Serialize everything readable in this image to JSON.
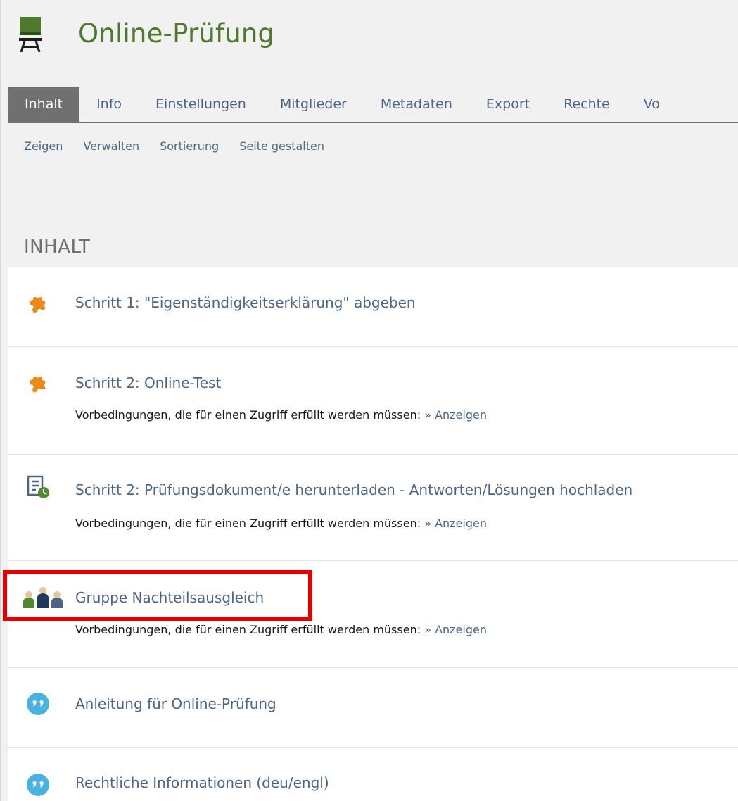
{
  "header": {
    "title": "Online-Prüfung",
    "icon": "classroom-desk-icon"
  },
  "tabs": [
    {
      "label": "Inhalt",
      "active": true
    },
    {
      "label": "Info"
    },
    {
      "label": "Einstellungen"
    },
    {
      "label": "Mitglieder"
    },
    {
      "label": "Metadaten"
    },
    {
      "label": "Export"
    },
    {
      "label": "Rechte"
    },
    {
      "label": "Vo"
    }
  ],
  "subtabs": [
    {
      "label": "Zeigen",
      "active": true
    },
    {
      "label": "Verwalten"
    },
    {
      "label": "Sortierung"
    },
    {
      "label": "Seite gestalten"
    }
  ],
  "section_title": "INHALT",
  "items": [
    {
      "title": "Schritt 1: \"Eigenständigkeitserklärung\" abgeben",
      "icon": "puzzle-icon"
    },
    {
      "title": "Schritt 2: Online-Test",
      "icon": "puzzle-icon",
      "meta_prefix": "Vorbedingungen, die für einen Zugriff erfüllt werden müssen:",
      "meta_link": "» Anzeigen"
    },
    {
      "title": "Schritt 2: Prüfungsdokument/e herunterladen - Antworten/Lösungen hochladen",
      "icon": "exercise-document-icon",
      "meta_prefix": "Vorbedingungen, die für einen Zugriff erfüllt werden müssen:",
      "meta_link": "» Anzeigen"
    },
    {
      "title": "Gruppe Nachteilsausgleich",
      "icon": "group-icon",
      "meta_prefix": "Vorbedingungen, die für einen Zugriff erfüllt werden müssen:",
      "meta_link": "» Anzeigen"
    },
    {
      "title": "Anleitung für Online-Prüfung",
      "icon": "wiki-icon"
    },
    {
      "title": "Rechtliche Informationen (deu/engl)",
      "icon": "wiki-icon"
    }
  ],
  "colors": {
    "accent_green": "#4f7a2d",
    "link_blue": "#4c6586",
    "puzzle_orange": "#e8891a",
    "wiki_blue": "#4ab2e0",
    "highlight_red": "#e30000"
  }
}
